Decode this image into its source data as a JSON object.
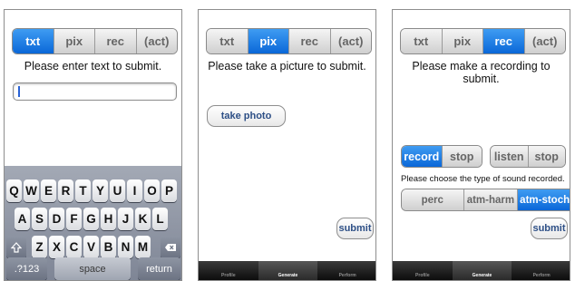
{
  "modes": [
    "txt",
    "pix",
    "rec",
    "(act)"
  ],
  "screens": [
    {
      "prompt": "Please enter text to submit.",
      "selected_mode": "txt"
    },
    {
      "prompt": "Please take a picture to submit.",
      "selected_mode": "pix"
    },
    {
      "prompt": "Please make a recording to submit.",
      "selected_mode": "rec"
    }
  ],
  "text_input": {
    "value": ""
  },
  "keyboard": {
    "row1": [
      "Q",
      "W",
      "E",
      "R",
      "T",
      "Y",
      "U",
      "I",
      "O",
      "P"
    ],
    "row2": [
      "A",
      "S",
      "D",
      "F",
      "G",
      "H",
      "J",
      "K",
      "L"
    ],
    "row3": [
      "Z",
      "X",
      "C",
      "V",
      "B",
      "N",
      "M"
    ],
    "numbers_key": ".?123",
    "space_key": "space",
    "return_key": "return"
  },
  "pix": {
    "take_photo_label": "take photo"
  },
  "submit_label": "submit",
  "rec": {
    "record_label": "record",
    "stop_label": "stop",
    "listen_label": "listen",
    "choose_text": "Please choose the type of sound recorded.",
    "sound_types": [
      "perc",
      "atm-harm",
      "atm-stoch"
    ],
    "selected_sound_type": "atm-stoch"
  },
  "tabs": [
    "Profile",
    "Generate",
    "Perform"
  ],
  "active_tab": "Generate",
  "colors": {
    "accent": "#0a67d8",
    "link_text": "#2d4f86"
  }
}
